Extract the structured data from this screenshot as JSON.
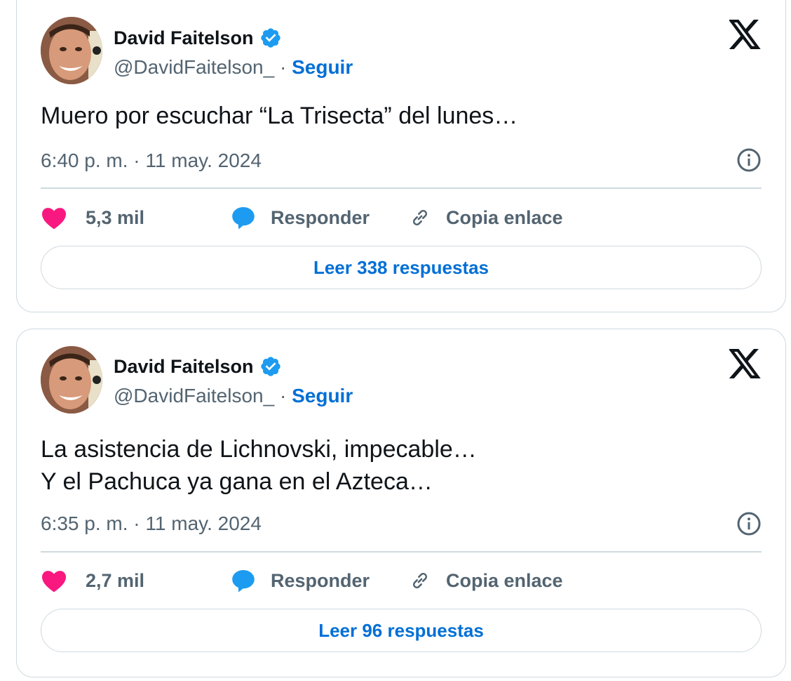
{
  "colors": {
    "accent": "#006fd6",
    "like": "#f91880",
    "reply": "#1d9bf0",
    "muted": "#536471",
    "border": "#cfd9de",
    "verified": "#1d9bf0"
  },
  "tweets": [
    {
      "author_name": "David Faitelson",
      "handle": "@DavidFaitelson_",
      "separator": "·",
      "follow_label": "Seguir",
      "text": "Muero por escuchar “La Trisecta” del lunes…",
      "time": "6:40 p. m.",
      "date_sep": "·",
      "date": "11 may. 2024",
      "likes": "5,3 mil",
      "reply_label": "Responder",
      "copy_label": "Copia enlace",
      "read_label": "Leer 338 respuestas",
      "icons": [
        "verified-badge-icon",
        "x-logo-icon",
        "info-icon",
        "heart-icon",
        "reply-bubble-icon",
        "link-icon"
      ]
    },
    {
      "author_name": "David Faitelson",
      "handle": "@DavidFaitelson_",
      "separator": "·",
      "follow_label": "Seguir",
      "text": "La asistencia de Lichnovski, impecable…\nY el Pachuca ya gana en el Azteca…",
      "time": "6:35 p. m.",
      "date_sep": "·",
      "date": "11 may. 2024",
      "likes": "2,7 mil",
      "reply_label": "Responder",
      "copy_label": "Copia enlace",
      "read_label": "Leer 96 respuestas",
      "icons": [
        "verified-badge-icon",
        "x-logo-icon",
        "info-icon",
        "heart-icon",
        "reply-bubble-icon",
        "link-icon"
      ]
    }
  ]
}
